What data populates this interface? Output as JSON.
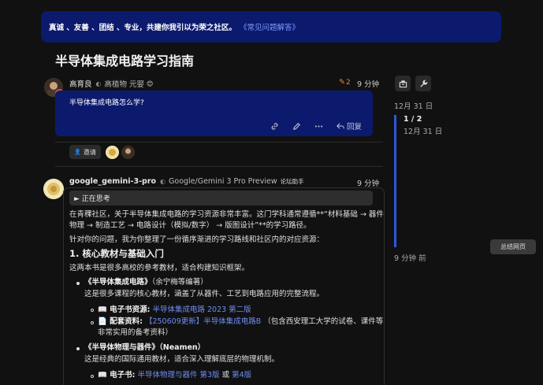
{
  "banner": {
    "text": "真诚 、友善 、团结 、专业，共建你我引以为荣之社区。",
    "link": "《常见问题解答》"
  },
  "topic": {
    "title": "半导体集成电路学习指南"
  },
  "post1": {
    "username": "高育良",
    "title": "高植物 元婴",
    "title_emoji": "😊",
    "edit_count": "2",
    "time": "9 分钟",
    "body": "半导体集成电路怎么学?",
    "reply_label": "回复"
  },
  "invite": {
    "label": "邀请"
  },
  "post2": {
    "username": "google_gemini-3-pro",
    "title": "Google/Gemini 3 Pro Preview",
    "badge": "论坛助手",
    "time": "9 分钟",
    "thinking": "► 正在思考",
    "p1a": "在青稞社区，关于半导体集成电路的学习资源非常丰富。这门学科通常遵循**“材料基础 → 器件",
    "p1b": "物理 → 制造工艺 → 电路设计（模拟/数字） → 版图设计”**的学习路径。",
    "p2": "针对你的问题，我为你整理了一份循序渐进的学习路线和社区内的对应资源：",
    "h3": "1. 核心教材与基础入门",
    "p3": "这两本书是很多高校的参考教材，适合构建知识框架。",
    "book1_title": "《半导体集成电路》",
    "book1_author": "（余宁梅等编著）",
    "book1_desc": "这是很多课程的核心教材，涵盖了从器件、工艺到电路应用的完整流程。",
    "ebook_label": "📖 电子书资源:",
    "ebook_link": "半导体集成电路 2023 第二版",
    "supp_label": "📄 配套资料:",
    "supp_link": "【250609更新】半导体集成电路B",
    "supp_tail1": "（包含西安理工大学的试卷、课件等",
    "supp_tail2": "非常实用的备考资料）",
    "book2_title": "《半导体物理与器件》",
    "book2_author": "（Neamen）",
    "book2_desc": "这是经典的国际通用教材，适合深入理解底层的物理机制。",
    "ebook2_label": "📖 电子书:",
    "ebook2_link1": "半导体物理与器件 第3版",
    "ebook2_or": "或",
    "ebook2_link2": "第4版"
  },
  "timeline": {
    "top_date": "12月 31 日",
    "counter": "1 / 2",
    "counter_date": "12月 31 日",
    "bottom_label": "9 分钟 前"
  },
  "summary": {
    "label": "总结网页"
  },
  "colors": {
    "accent": "#0c1a6e",
    "link": "#6e8cf0",
    "timeline": "#2e55e0",
    "edit": "#e8843c"
  }
}
